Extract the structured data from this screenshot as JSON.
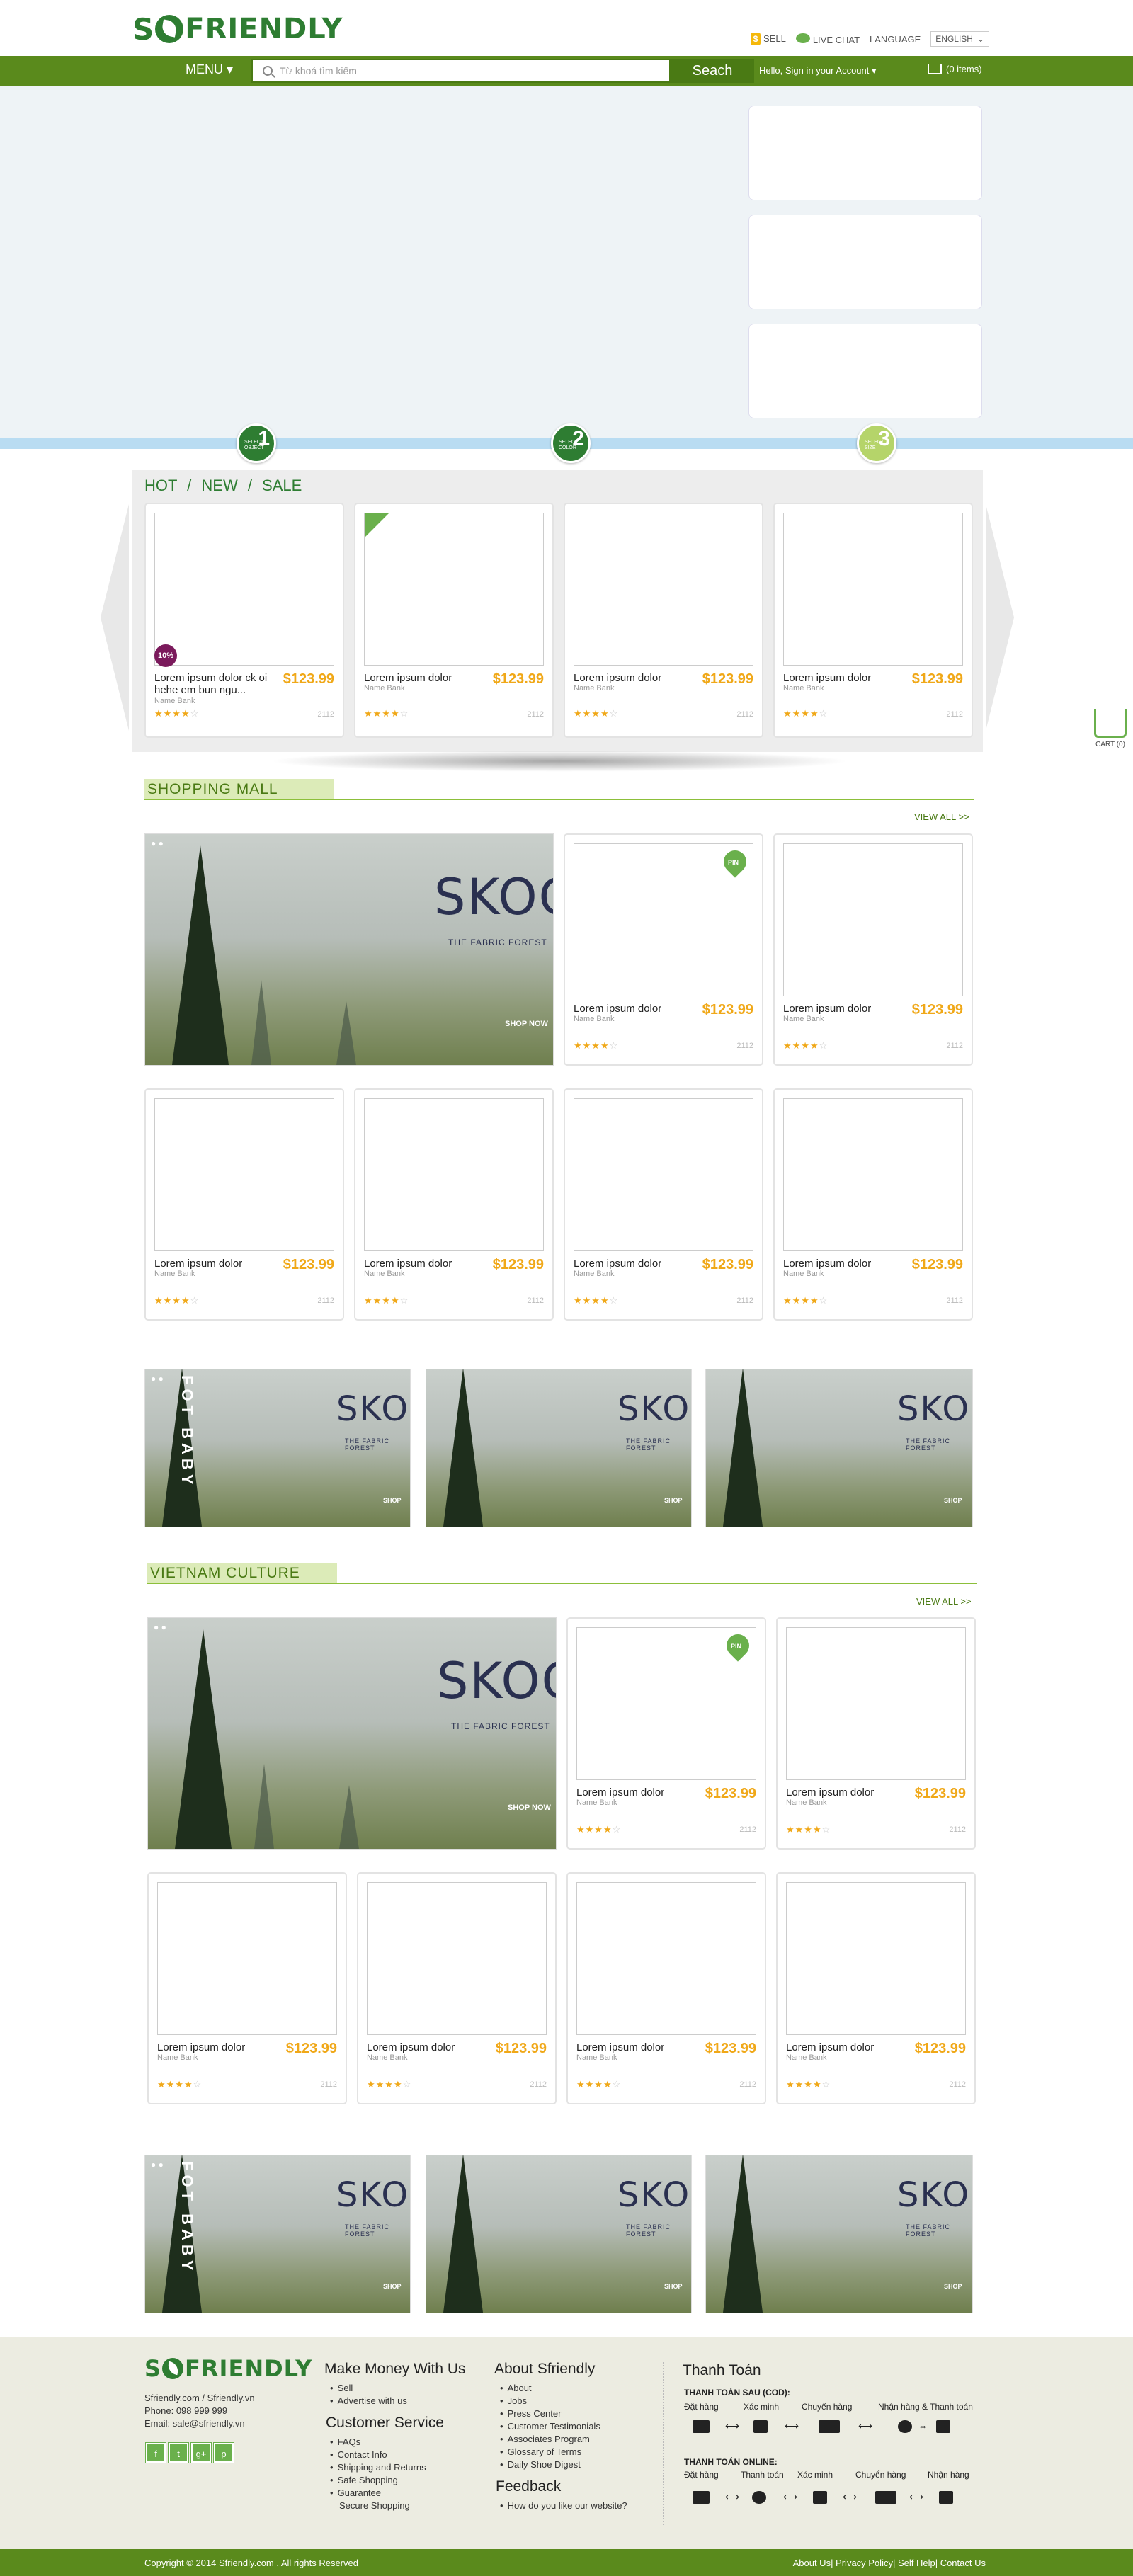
{
  "header": {
    "logo_prefix": "S",
    "logo_word": "FRIENDLY",
    "sell": "SELL",
    "live_chat": "LIVE CHAT",
    "language_label": "LANGUAGE",
    "language_value": "ENGLISH"
  },
  "nav": {
    "menu": "MENU ▾",
    "search_placeholder": "Từ khoá tìm kiếm",
    "search_button": "Seach",
    "signin": "Hello, Sign in your Account ▾",
    "cart": "(0 items)"
  },
  "steps": [
    {
      "num": "1",
      "text": "SELECT OBJECT"
    },
    {
      "num": "2",
      "text": "SELECT COLOR"
    },
    {
      "num": "3",
      "text": "SELECT SIZE"
    }
  ],
  "hns": {
    "title": "HOT  /  NEW  / SALE",
    "cards": [
      {
        "name": "Lorem ipsum dolor ck oi hehe em bun ngu...",
        "brand": "Name Bank",
        "price": "$123.99",
        "views": "2112",
        "badge": "10%"
      },
      {
        "name": "Lorem ipsum dolor",
        "brand": "Name Bank",
        "price": "$123.99",
        "views": "2112"
      },
      {
        "name": "Lorem ipsum dolor",
        "brand": "Name Bank",
        "price": "$123.99",
        "views": "2112"
      },
      {
        "name": "Lorem ipsum dolor",
        "brand": "Name Bank",
        "price": "$123.99",
        "views": "2112"
      }
    ]
  },
  "side_cart": "CART (0)",
  "shopping_mall": {
    "title": "SHOPPING MALL",
    "view_all": "VIEW ALL >>",
    "pin": "PIN",
    "product": {
      "name": "Lorem ipsum dolor",
      "brand": "Name Bank",
      "price": "$123.99",
      "views": "2112"
    }
  },
  "vietnam_culture": {
    "title": "VIETNAM CULTURE",
    "view_all": "VIEW ALL >>"
  },
  "banner": {
    "brand": "SKOG",
    "subtitle": "THE FABRIC FOREST",
    "shop_now": "SHOP NOW",
    "shop_small": "SHOP",
    "vertical": "FOT BABY"
  },
  "rating": {
    "filled": "★★★★",
    "empty": "☆"
  },
  "footer": {
    "logo_prefix": "S",
    "logo_word": "FRIENDLY",
    "site": "Sfriendly.com  /  Sfriendly.vn",
    "phone": "Phone: 098 999 999",
    "email": "Email: sale@sfriendly.vn",
    "social": [
      "f",
      "t",
      "g+",
      "p"
    ],
    "make_money_title": "Make Money With Us",
    "make_money": [
      "Sell",
      "Advertise with us"
    ],
    "customer_service_title": "Customer Service",
    "customer_service": [
      "FAQs",
      "Contact Info",
      "Shipping and Returns",
      "Safe Shopping",
      "Guarantee",
      "Secure Shopping"
    ],
    "about_title": "About Sfriendly",
    "about": [
      "About",
      "Jobs",
      "Press Center",
      "Customer Testimonials",
      "Associates Program",
      "Glossary of Terms",
      "Daily Shoe Digest"
    ],
    "feedback_title": "Feedback",
    "feedback": [
      "How do you like our website?"
    ],
    "payment_title": "Thanh Toán",
    "cod_title": "THANH TOÁN SAU (COD):",
    "cod_steps": [
      "Đặt hàng",
      "Xác minh",
      "Chuyển hàng",
      "Nhận hàng & Thanh toán"
    ],
    "online_title": "THANH TOÁN ONLINE:",
    "online_steps": [
      "Đặt hàng",
      "Thanh toán",
      "Xác minh",
      "Chuyển hàng",
      "Nhận hàng"
    ],
    "copyright": "Copyright © 2014 Sfriendly.com . All rights Reserved",
    "bottom_links": "About Us| Privacy Policy| Self Help| Contact Us"
  }
}
